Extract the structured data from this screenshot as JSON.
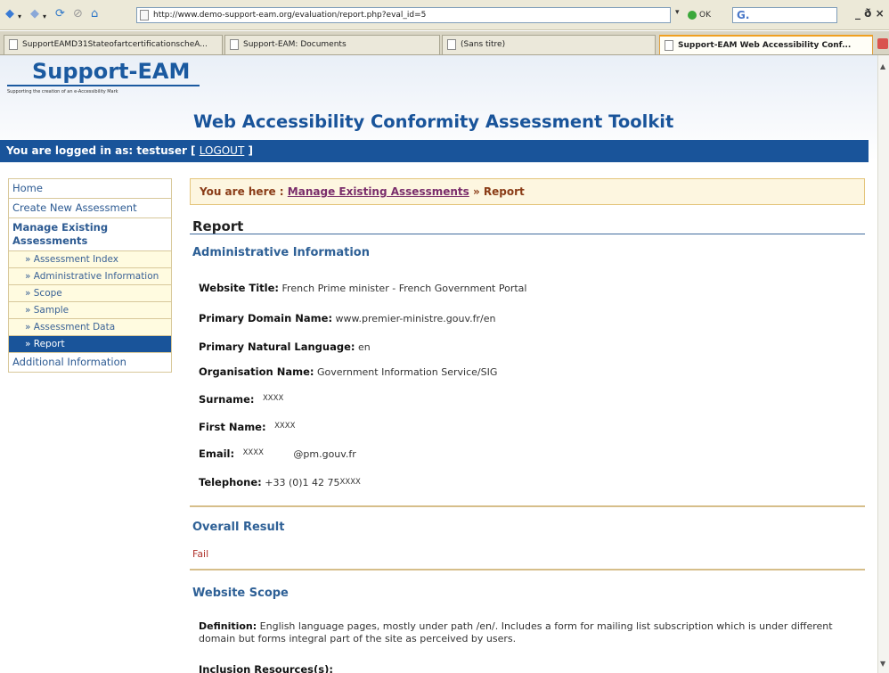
{
  "browser": {
    "url": "http://www.demo-support-eam.org/evaluation/report.php?eval_id=5",
    "go_label": "OK",
    "search_value": "G.",
    "window_buttons": "_ ð ×",
    "tabs": [
      {
        "label": "SupportEAMD31StateofartcertificationscheA..."
      },
      {
        "label": "Support-EAM: Documents"
      },
      {
        "label": "(Sans titre)"
      },
      {
        "label": "Support-EAM Web Accessibility Conf..."
      }
    ]
  },
  "site": {
    "logo": "Support-EAM",
    "tagline": "Supporting the creation of an e-Accessibility Mark",
    "title": "Web Accessibility Conformity Assessment Toolkit"
  },
  "login": {
    "prefix": "You are logged in as: testuser [",
    "logout": "LOGOUT",
    "suffix": "]"
  },
  "sidebar": {
    "items": [
      {
        "label": "Home"
      },
      {
        "label": "Create New Assessment"
      }
    ],
    "section": "Manage Existing Assessments",
    "sub_items": [
      {
        "label": "» Assessment Index"
      },
      {
        "label": "» Administrative Information"
      },
      {
        "label": "» Scope"
      },
      {
        "label": "» Sample"
      },
      {
        "label": "» Assessment Data"
      },
      {
        "label": "» Report"
      }
    ],
    "additional": "Additional Information"
  },
  "breadcrumb": {
    "prefix": "You are here :",
    "link": "Manage Existing Assessments",
    "current": "» Report"
  },
  "report": {
    "title": "Report",
    "admin_heading": "Administrative Information",
    "fields": [
      {
        "label": "Website Title:",
        "value": "French Prime minister - French Government Portal"
      },
      {
        "label": "Primary Domain Name:",
        "value": "www.premier-ministre.gouv.fr/en"
      },
      {
        "label": "Primary Natural Language:",
        "value": "en"
      },
      {
        "label": "Organisation Name:",
        "value": "Government Information Service/SIG"
      },
      {
        "label": "Surname:",
        "value": "XXXX"
      },
      {
        "label": "First Name:",
        "value": "XXXX"
      },
      {
        "label": "Email:",
        "value": "XXXX",
        "value2": "@pm.gouv.fr"
      },
      {
        "label": "Telephone:",
        "value": "+33 (0)1 42 75",
        "value2": "XXXX"
      }
    ],
    "overall_heading": "Overall Result",
    "overall_value": "Fail",
    "scope_heading": "Website Scope",
    "definition_label": "Definition:",
    "definition_text": "English language pages, mostly under path /en/. Includes a form for mailing list subscription which is under different domain but forms integral part of the site as perceived by users.",
    "inclusion_label": "Inclusion Resources(s):"
  }
}
